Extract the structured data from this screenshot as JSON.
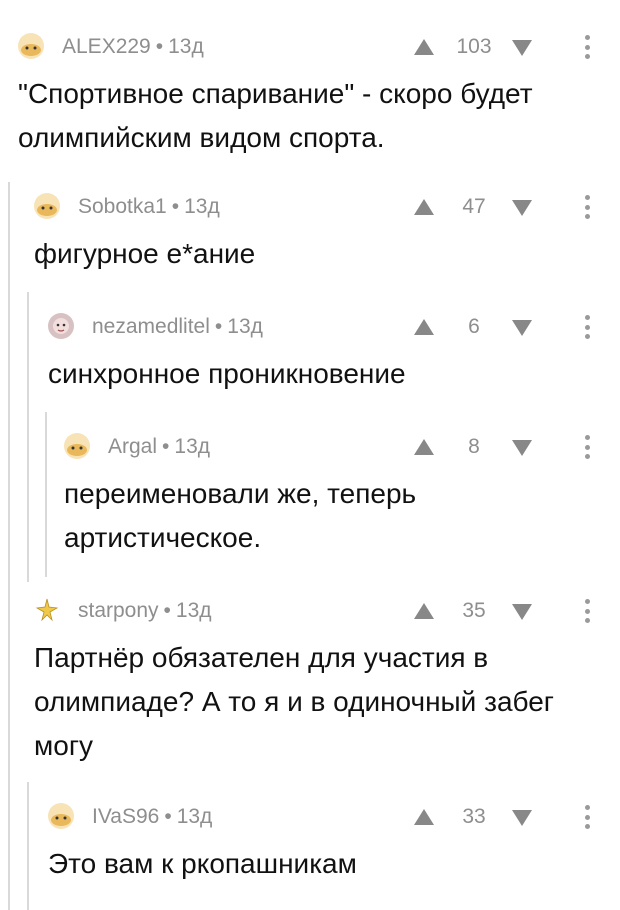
{
  "comments": [
    {
      "author": "ALEX229",
      "time": "13д",
      "rating": "103",
      "text": "\"Спортивное спаривание\" - скоро будет олимпийским видом спорта."
    },
    {
      "author": "Sobotka1",
      "time": "13д",
      "rating": "47",
      "text": "фигурное е*ание"
    },
    {
      "author": "nezamedlitel",
      "time": "13д",
      "rating": "6",
      "text": "синхронное проникновение"
    },
    {
      "author": "Argal",
      "time": "13д",
      "rating": "8",
      "text": "переименовали же, теперь артистическое."
    },
    {
      "author": "starpony",
      "time": "13д",
      "rating": "35",
      "text": "Партнёр обязателен для участия в олимпиаде? А то я и в одиночный забег могу"
    },
    {
      "author": "IVaS96",
      "time": "13д",
      "rating": "33",
      "text": "Это вам к ркопашникам"
    }
  ],
  "meta_separator": "•",
  "icons": {
    "upvote": "arrow-up-icon",
    "downvote": "arrow-down-icon",
    "more": "more-vertical-icon"
  },
  "colors": {
    "text": "#111111",
    "meta": "#8e8e8e",
    "thread_line": "#d9d9d9",
    "icons": "#888888"
  }
}
